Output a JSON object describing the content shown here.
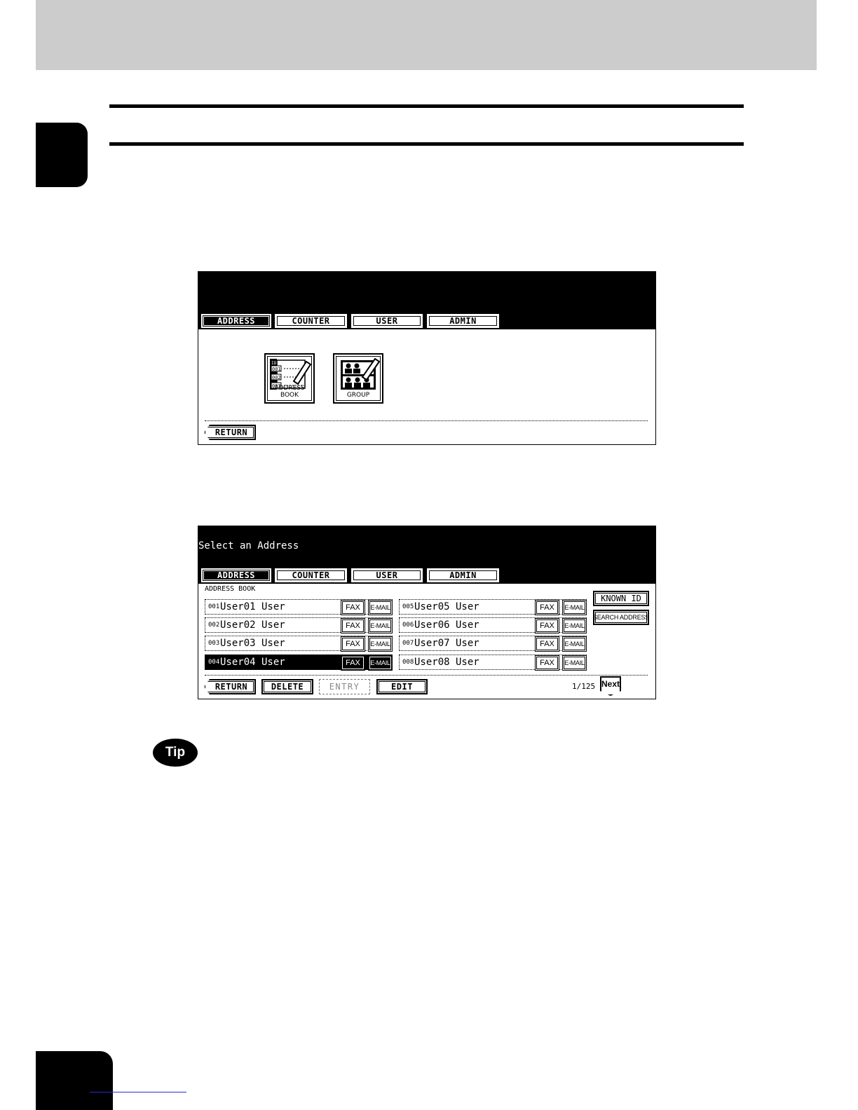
{
  "screen1": {
    "tabs": [
      "ADDRESS",
      "COUNTER",
      "USER",
      "ADMIN"
    ],
    "icons": {
      "address_book": "ADDRESS BOOK",
      "group": "GROUP"
    },
    "return_label": "RETURN"
  },
  "screen2": {
    "title": "Select an Address",
    "tabs": [
      "ADDRESS",
      "COUNTER",
      "USER",
      "ADMIN"
    ],
    "section_label": "ADDRESS BOOK",
    "entries": [
      {
        "num": "001",
        "name": "User01 User"
      },
      {
        "num": "002",
        "name": "User02 User"
      },
      {
        "num": "003",
        "name": "User03 User"
      },
      {
        "num": "004",
        "name": "User04 User"
      },
      {
        "num": "005",
        "name": "User05 User"
      },
      {
        "num": "006",
        "name": "User06 User"
      },
      {
        "num": "007",
        "name": "User07 User"
      },
      {
        "num": "008",
        "name": "User08 User"
      }
    ],
    "fax_label": "FAX",
    "email_label": "E-MAIL",
    "known_id_label": "KNOWN ID",
    "search_address_label": "SEARCH ADDRESS",
    "buttons": {
      "return": "RETURN",
      "delete": "DELETE",
      "entry": "ENTRY",
      "edit": "EDIT"
    },
    "page_count": "1/125",
    "next_label": "Next"
  },
  "tip_label": "Tip"
}
